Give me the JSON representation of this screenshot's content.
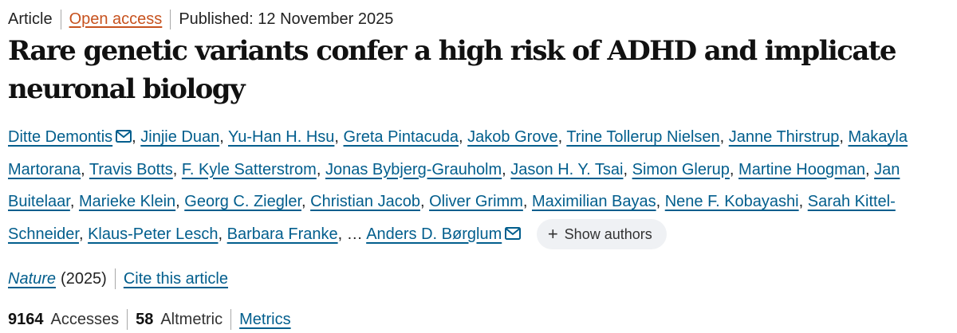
{
  "header": {
    "article_type": "Article",
    "access": "Open access",
    "published": "Published: 12 November 2025"
  },
  "title": "Rare genetic variants confer a high risk of ADHD and implicate neuronal biology",
  "authors": [
    {
      "name": "Ditte Demontis",
      "corresponding": true
    },
    {
      "name": "Jinjie Duan"
    },
    {
      "name": "Yu-Han H. Hsu"
    },
    {
      "name": "Greta Pintacuda"
    },
    {
      "name": "Jakob Grove"
    },
    {
      "name": "Trine Tollerup Nielsen"
    },
    {
      "name": "Janne Thirstrup"
    },
    {
      "name": "Makayla Martorana"
    },
    {
      "name": "Travis Botts"
    },
    {
      "name": "F. Kyle Satterstrom"
    },
    {
      "name": "Jonas Bybjerg-Grauholm"
    },
    {
      "name": "Jason H. Y. Tsai"
    },
    {
      "name": "Simon Glerup"
    },
    {
      "name": "Martine Hoogman"
    },
    {
      "name": "Jan Buitelaar"
    },
    {
      "name": "Marieke Klein"
    },
    {
      "name": "Georg C. Ziegler"
    },
    {
      "name": "Christian Jacob"
    },
    {
      "name": "Oliver Grimm"
    },
    {
      "name": "Maximilian Bayas"
    },
    {
      "name": "Nene F. Kobayashi"
    },
    {
      "name": "Sarah Kittel-Schneider"
    },
    {
      "name": "Klaus-Peter Lesch"
    },
    {
      "name": "Barbara Franke"
    },
    {
      "name": "Anders D. Børglum",
      "corresponding": true
    }
  ],
  "authors_ellipsis": "…",
  "show_authors_label": "Show authors",
  "citation": {
    "journal": "Nature",
    "year": "(2025)",
    "cite_label": "Cite this article"
  },
  "metrics": {
    "accesses_count": "9164",
    "accesses_label": "Accesses",
    "altmetric_count": "58",
    "altmetric_label": "Altmetric",
    "metrics_link": "Metrics"
  },
  "colors": {
    "link": "#025e8d",
    "open_access": "#c7521e",
    "text": "#222222",
    "button_bg": "#eff1f4"
  },
  "icons": {
    "mail": "envelope-icon",
    "plus": "plus-icon"
  }
}
